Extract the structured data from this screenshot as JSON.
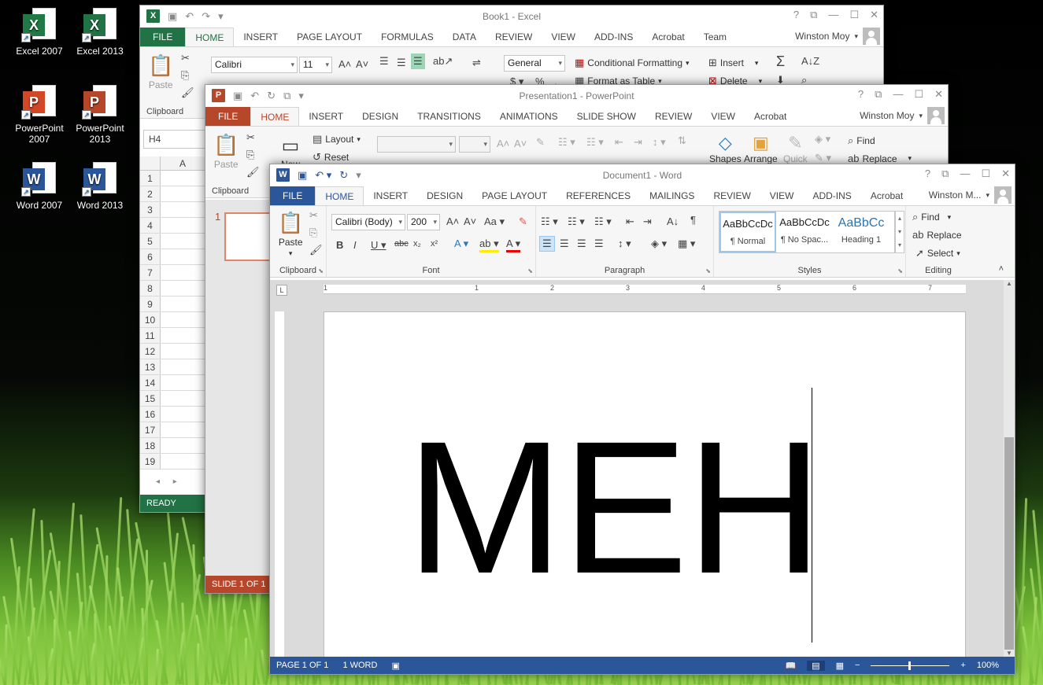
{
  "desktop": {
    "icons": [
      {
        "label": "Excel 2007",
        "letter": "X",
        "color": "#1f7a45"
      },
      {
        "label": "Excel 2013",
        "letter": "X",
        "color": "#217346"
      },
      {
        "label": "PowerPoint 2007",
        "letter": "P",
        "color": "#d24726"
      },
      {
        "label": "PowerPoint 2013",
        "letter": "P",
        "color": "#b7472a"
      },
      {
        "label": "Word 2007",
        "letter": "W",
        "color": "#2a5699"
      },
      {
        "label": "Word 2013",
        "letter": "W",
        "color": "#2b579a"
      }
    ]
  },
  "excel": {
    "title": "Book1 - Excel",
    "tabs": [
      "FILE",
      "HOME",
      "INSERT",
      "PAGE LAYOUT",
      "FORMULAS",
      "DATA",
      "REVIEW",
      "VIEW",
      "ADD-INS",
      "Acrobat",
      "Team"
    ],
    "user": "Winston Moy",
    "font_name": "Calibri",
    "font_size": "11",
    "number_format": "General",
    "paste": "Paste",
    "clipboard": "Clipboard",
    "conditional_formatting": "Conditional Formatting",
    "format_as_table": "Format as Table",
    "insert": "Insert",
    "delete": "Delete",
    "namebox": "H4",
    "column": "A",
    "rows": [
      "1",
      "2",
      "3",
      "4",
      "5",
      "6",
      "7",
      "8",
      "9",
      "10",
      "11",
      "12",
      "13",
      "14",
      "15",
      "16",
      "17",
      "18",
      "19"
    ],
    "status": "READY"
  },
  "ppt": {
    "title": "Presentation1 - PowerPoint",
    "tabs": [
      "FILE",
      "HOME",
      "INSERT",
      "DESIGN",
      "TRANSITIONS",
      "ANIMATIONS",
      "SLIDE SHOW",
      "REVIEW",
      "VIEW",
      "Acrobat"
    ],
    "user": "Winston Moy",
    "paste": "Paste",
    "clipboard": "Clipboard",
    "layout": "Layout",
    "reset": "Reset",
    "new": "New",
    "shapes": "Shapes",
    "arrange": "Arrange",
    "quick": "Quick",
    "find": "Find",
    "replace": "Replace",
    "slide_num": "1",
    "status": "SLIDE 1 OF 1"
  },
  "word": {
    "title": "Document1 - Word",
    "tabs": [
      "FILE",
      "HOME",
      "INSERT",
      "DESIGN",
      "PAGE LAYOUT",
      "REFERENCES",
      "MAILINGS",
      "REVIEW",
      "VIEW",
      "ADD-INS",
      "Acrobat"
    ],
    "user": "Winston M...",
    "paste": "Paste",
    "font_name": "Calibri (Body)",
    "font_size": "200",
    "groups": {
      "clipboard": "Clipboard",
      "font": "Font",
      "paragraph": "Paragraph",
      "styles": "Styles",
      "editing": "Editing"
    },
    "styles": [
      {
        "sample": "AaBbCcDc",
        "name": "¶ Normal"
      },
      {
        "sample": "AaBbCcDc",
        "name": "¶ No Spac..."
      },
      {
        "sample": "AaBbCc",
        "name": "Heading 1"
      }
    ],
    "find": "Find",
    "replace": "Replace",
    "select": "Select",
    "ruler_numbers": [
      "1",
      "1",
      "2",
      "3",
      "4",
      "5",
      "6",
      "7"
    ],
    "document_text": "MEH",
    "status": {
      "page": "PAGE 1 OF 1",
      "words": "1 WORD",
      "zoom": "100%"
    },
    "accent": "#2b579a"
  }
}
